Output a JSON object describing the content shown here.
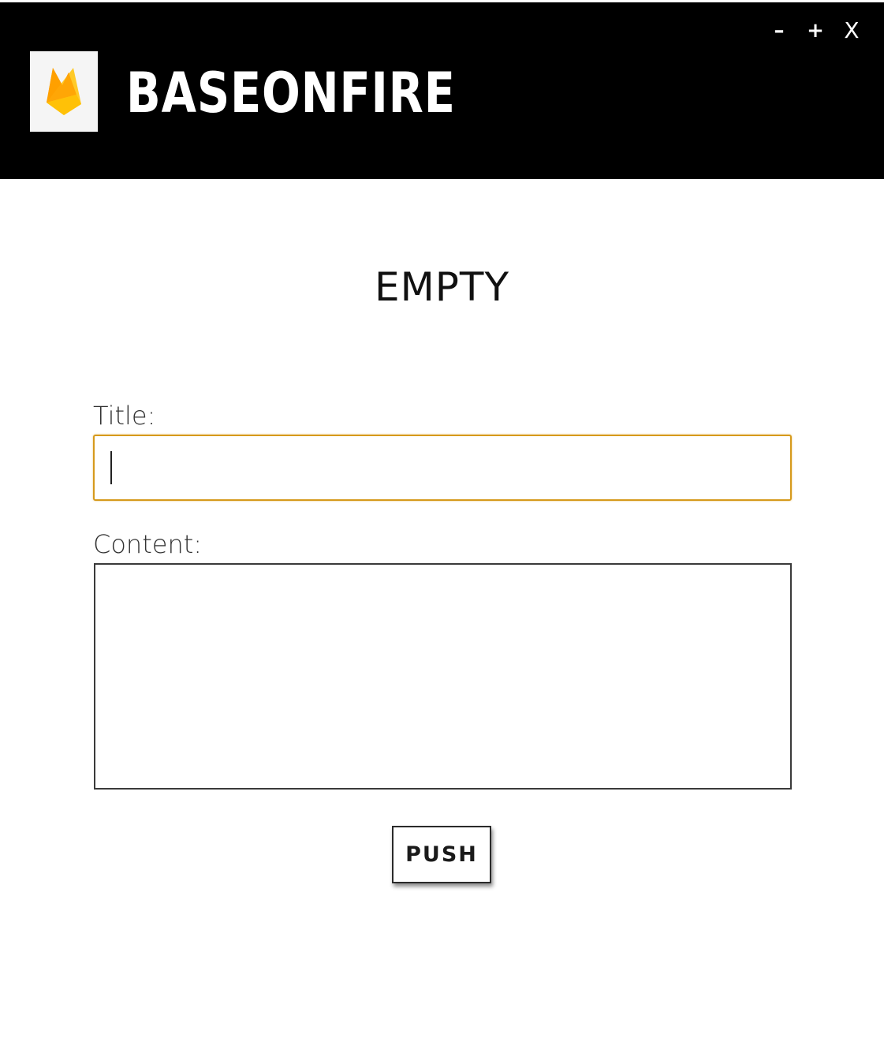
{
  "header": {
    "app_name": "BASEONFIRE",
    "background_color": "#000000",
    "logo_icon": "firebase-flame-icon",
    "controls": {
      "minimize_label": "–",
      "maximize_label": "+",
      "close_label": "X"
    }
  },
  "main": {
    "heading": "EMPTY",
    "title_field": {
      "label": "Title:",
      "value": "",
      "focused": true,
      "focus_color": "#d69a1c"
    },
    "content_field": {
      "label": "Content:",
      "value": ""
    },
    "push_button_label": "PUSH"
  }
}
